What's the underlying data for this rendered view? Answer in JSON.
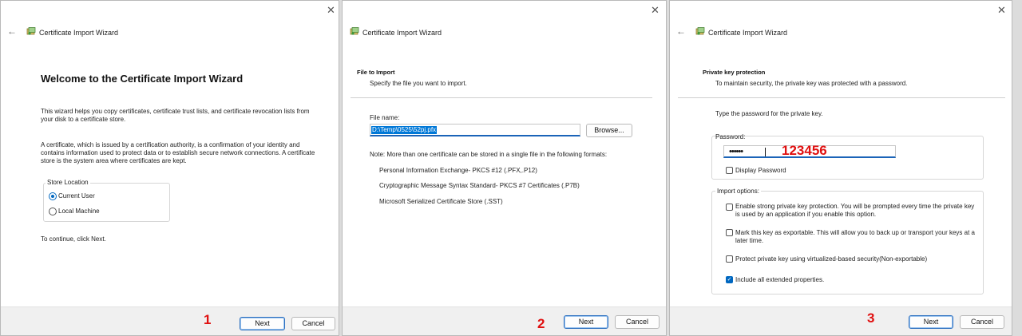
{
  "wizard_title": "Certificate Import Wizard",
  "buttons": {
    "next": "Next",
    "cancel": "Cancel"
  },
  "step_labels": [
    "1",
    "2",
    "3"
  ],
  "panel1": {
    "heading": "Welcome to the Certificate Import Wizard",
    "para1": "This wizard helps you copy certificates, certificate trust lists, and certificate revocation lists from your disk to a certificate store.",
    "para2": "A certificate, which is issued by a certification authority, is a confirmation of your identity and contains information used to protect data or to establish secure network connections. A certificate store is the system area where certificates are kept.",
    "store_location_label": "Store Location",
    "options": [
      {
        "label": "Current User",
        "selected": true
      },
      {
        "label": "Local Machine",
        "selected": false
      }
    ],
    "continue_text": "To continue, click Next."
  },
  "panel2": {
    "section_title": "File to Import",
    "section_sub": "Specify the file you want to import.",
    "file_name_label": "File name:",
    "file_name_value": "D:\\Temp\\0525\\52pj.pfx",
    "browse_label": "Browse...",
    "note": "Note:  More than one certificate can be stored in a single file in the following formats:",
    "formats": [
      "Personal Information Exchange- PKCS #12 (.PFX,.P12)",
      "Cryptographic Message Syntax Standard- PKCS #7 Certificates (.P7B)",
      "Microsoft Serialized Certificate Store (.SST)"
    ]
  },
  "panel3": {
    "section_title": "Private key protection",
    "section_sub": "To maintain security, the private key was protected with a password.",
    "instruction": "Type the password for the private key.",
    "password_label": "Password:",
    "password_mask": "••••••",
    "password_overlay": "123456",
    "display_password_label": "Display Password",
    "import_options_label": "Import options:",
    "options": [
      {
        "label": "Enable strong private key protection. You will be prompted every time the private key is used by an application if you enable this option.",
        "checked": false
      },
      {
        "label": "Mark this key as exportable. This will allow you to back up or transport your keys at a later time.",
        "checked": false
      },
      {
        "label": "Protect private key using virtualized-based security(Non-exportable)",
        "checked": false
      },
      {
        "label": "Include all extended properties.",
        "checked": true
      }
    ]
  },
  "icons": {
    "close": "close-icon",
    "back": "back-arrow-icon",
    "wizard": "certificate-icon",
    "check": "checkmark-icon"
  },
  "colors": {
    "accent": "#0067c0",
    "step_number": "#e01010",
    "footer": "#f0f0f0",
    "selection": "#0078d7"
  }
}
